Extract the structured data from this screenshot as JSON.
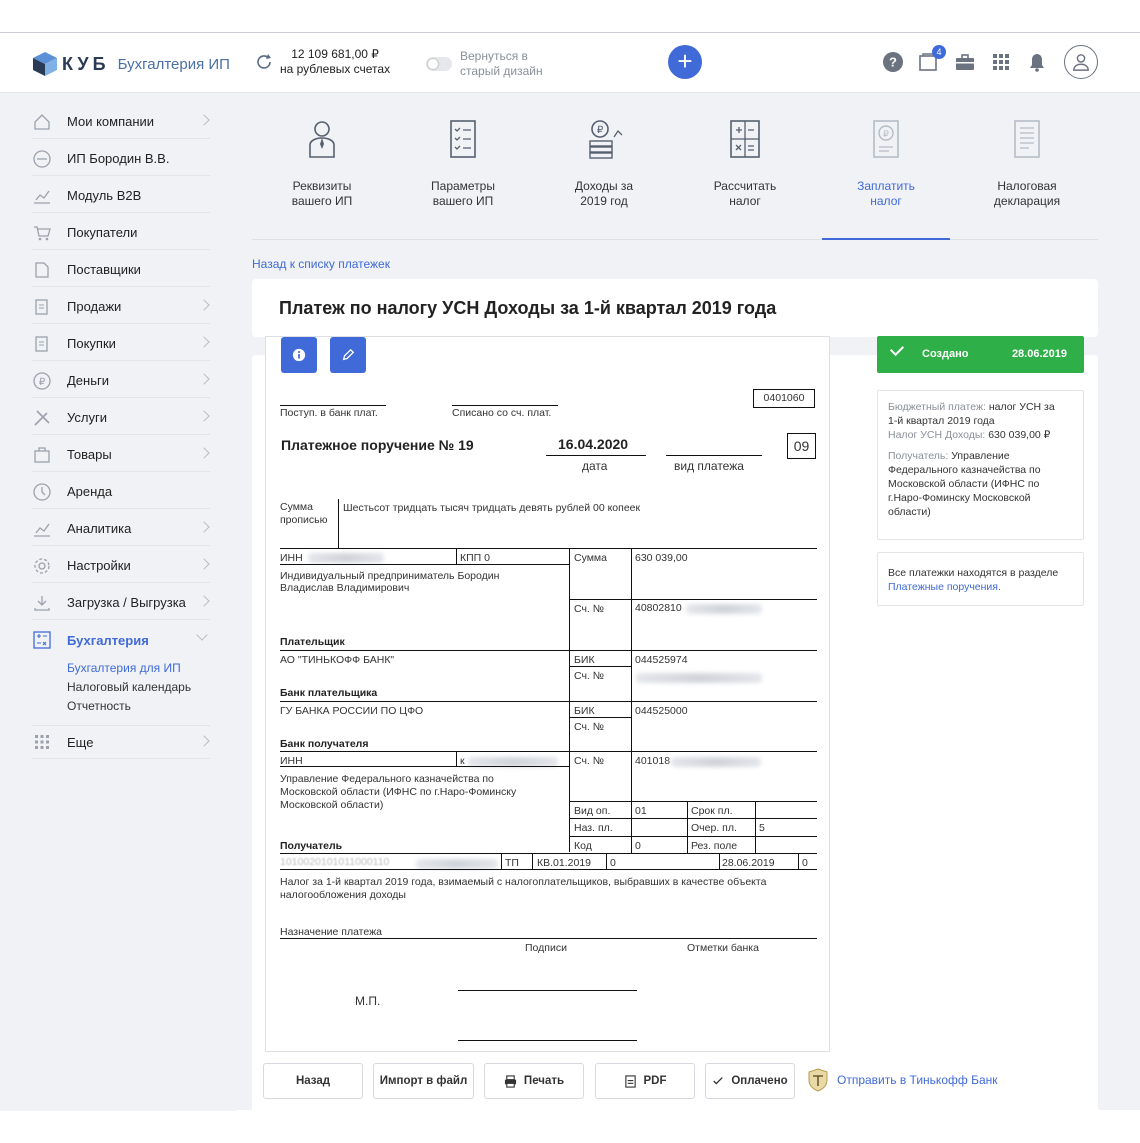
{
  "header": {
    "logo_text": "КУБ",
    "logo_sub": "Бухгалтерия ИП",
    "balance_amount": "12 109 681,00 ₽",
    "balance_caption": "на рублевых счетах",
    "toggle_line1": "Вернуться в",
    "toggle_line2": "старый дизайн",
    "add_symbol": "+",
    "notifications_badge": "4"
  },
  "sidebar": {
    "items": [
      {
        "label": "Мои компании",
        "icon": "home-icon"
      },
      {
        "label": "ИП Бородин В.В.",
        "icon": "company-icon"
      },
      {
        "label": "Модуль B2B",
        "icon": "chart-icon"
      },
      {
        "label": "Покупатели",
        "icon": "cart-icon"
      },
      {
        "label": "Поставщики",
        "icon": "supplier-icon"
      },
      {
        "label": "Продажи",
        "icon": "sales-icon"
      },
      {
        "label": "Покупки",
        "icon": "purchases-icon"
      },
      {
        "label": "Деньги",
        "icon": "money-icon"
      },
      {
        "label": "Услуги",
        "icon": "tools-icon"
      },
      {
        "label": "Товары",
        "icon": "goods-icon"
      },
      {
        "label": "Аренда",
        "icon": "rent-icon"
      },
      {
        "label": "Аналитика",
        "icon": "analytics-icon"
      },
      {
        "label": "Настройки",
        "icon": "gear-icon"
      },
      {
        "label": "Загрузка / Выгрузка",
        "icon": "upload-icon"
      },
      {
        "label": "Бухгалтерия",
        "icon": "accounting-icon"
      },
      {
        "label": "Еще",
        "icon": "grid-icon"
      }
    ],
    "sub_items": [
      "Бухгалтерия для ИП",
      "Налоговый календарь",
      "Отчетность"
    ]
  },
  "tabs": [
    {
      "line1": "Реквизиты",
      "line2": "вашего ИП"
    },
    {
      "line1": "Параметры",
      "line2": "вашего ИП"
    },
    {
      "line1": "Доходы за",
      "line2": "2019 год"
    },
    {
      "line1": "Рассчитать",
      "line2": "налог"
    },
    {
      "line1": "Заплатить",
      "line2": "налог"
    },
    {
      "line1": "Налоговая",
      "line2": "декларация"
    }
  ],
  "back_link": "Назад к списку платежек",
  "page_title": "Платеж по налогу УСН Доходы за 1-й квартал 2019 года",
  "document": {
    "form_code": "0401060",
    "received_label": "Поступ. в банк плат.",
    "debited_label": "Списано со сч. плат.",
    "order_title": "Платежное поручение № 19",
    "date_value": "16.04.2020",
    "date_label": "дата",
    "payment_type_label": "вид платежа",
    "status_code": "09",
    "sum_words_label_1": "Сумма",
    "sum_words_label_2": "прописью",
    "sum_words": "Шестьсот тридцать тысяч тридцать девять рублей 00 копеек",
    "inn_label": "ИНН",
    "kpp_label": "КПП 0",
    "sum_label": "Сумма",
    "sum_value": "630 039,00",
    "payer_name_1": "Индивидуальный предприниматель Бородин",
    "payer_name_2": "Владислав Владимирович",
    "account_label": "Сч. №",
    "payer_account": "40802810",
    "payer_label": "Плательщик",
    "payer_bank": "АО \"ТИНЬКОФФ БАНК\"",
    "bik_label": "БИК",
    "payer_bik": "044525974",
    "payer_bank_label": "Банк плательщика",
    "recipient_bank": "ГУ БАНКА РОССИИ ПО ЦФО",
    "recipient_bik": "044525000",
    "recipient_bank_label": "Банк получателя",
    "recipient_kpp_prefix": "к",
    "recipient_account": "401018",
    "recipient_name_1": "Управление Федерального казначейства по",
    "recipient_name_2": "Московской области (ИФНС по г.Наро-Фоминску",
    "recipient_name_3": "Московской области)",
    "op_type_label": "Вид оп.",
    "op_type_value": "01",
    "due_label": "Срок пл.",
    "purpose_code_label": "Наз. пл.",
    "priority_label": "Очер. пл.",
    "priority_value": "5",
    "code_label": "Код",
    "code_value": "0",
    "reserve_label": "Рез. поле",
    "recipient_label": "Получатель",
    "tax_row_partial": "1010020101011000110",
    "tax_basis": "ТП",
    "tax_period": "КВ.01.2019",
    "tax_doc_no": "0",
    "tax_doc_date": "28.06.2019",
    "tax_type": "0",
    "purpose_1": "Налог за 1-й квартал 2019 года, взимаемый с налогоплательщиков, выбравших в качестве объекта",
    "purpose_2": "налогообложения доходы",
    "purpose_label": "Назначение платежа",
    "signatures_label": "Подписи",
    "bank_marks_label": "Отметки банка",
    "stamp_label": "М.П."
  },
  "status": {
    "label": "Создано",
    "date": "28.06.2019"
  },
  "info_card_1": {
    "budget_label": "Бюджетный платеж:",
    "budget_value_1": "налог УСН за",
    "budget_value_2": "1-й квартал 2019 года",
    "tax_label": "Налог УСН Доходы:",
    "tax_value": "630 039,00 ₽",
    "recipient_label": "Получатель:",
    "recipient_value_1": "Управление",
    "recipient_value_2": "Федерального казначейства по",
    "recipient_value_3": "Московской области (ИФНС по",
    "recipient_value_4": "г.Наро-Фоминску Московской",
    "recipient_value_5": "области)"
  },
  "info_card_2": {
    "text": "Все платежки находятся в разделе",
    "link": "Платежные поручения."
  },
  "actions": {
    "back": "Назад",
    "import": "Импорт в файл",
    "print": "Печать",
    "pdf": "PDF",
    "paid": "Оплачено",
    "send_bank": "Отправить в Тинькофф Банк"
  },
  "colors": {
    "accent": "#3f6ad8",
    "status_green": "#2eaf48"
  }
}
